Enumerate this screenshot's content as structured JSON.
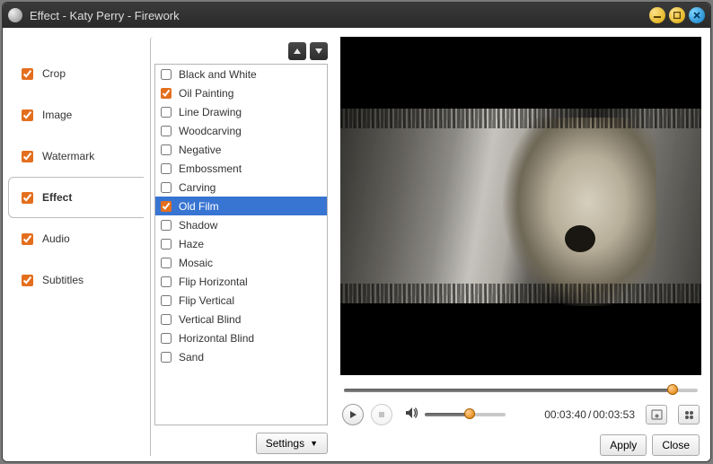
{
  "window": {
    "title": "Effect - Katy Perry - Firework"
  },
  "tabs": [
    {
      "id": "crop",
      "label": "Crop",
      "checked": true,
      "active": false
    },
    {
      "id": "image",
      "label": "Image",
      "checked": true,
      "active": false
    },
    {
      "id": "watermark",
      "label": "Watermark",
      "checked": true,
      "active": false
    },
    {
      "id": "effect",
      "label": "Effect",
      "checked": true,
      "active": true
    },
    {
      "id": "audio",
      "label": "Audio",
      "checked": true,
      "active": false
    },
    {
      "id": "subtitles",
      "label": "Subtitles",
      "checked": true,
      "active": false
    }
  ],
  "effects": [
    {
      "label": "Black and White",
      "checked": false,
      "selected": false
    },
    {
      "label": "Oil Painting",
      "checked": true,
      "selected": false
    },
    {
      "label": "Line Drawing",
      "checked": false,
      "selected": false
    },
    {
      "label": "Woodcarving",
      "checked": false,
      "selected": false
    },
    {
      "label": "Negative",
      "checked": false,
      "selected": false
    },
    {
      "label": "Embossment",
      "checked": false,
      "selected": false
    },
    {
      "label": "Carving",
      "checked": false,
      "selected": false
    },
    {
      "label": "Old Film",
      "checked": true,
      "selected": true
    },
    {
      "label": "Shadow",
      "checked": false,
      "selected": false
    },
    {
      "label": "Haze",
      "checked": false,
      "selected": false
    },
    {
      "label": "Mosaic",
      "checked": false,
      "selected": false
    },
    {
      "label": "Flip Horizontal",
      "checked": false,
      "selected": false
    },
    {
      "label": "Flip Vertical",
      "checked": false,
      "selected": false
    },
    {
      "label": "Vertical Blind",
      "checked": false,
      "selected": false
    },
    {
      "label": "Horizontal Blind",
      "checked": false,
      "selected": false
    },
    {
      "label": "Sand",
      "checked": false,
      "selected": false
    }
  ],
  "buttons": {
    "settings": "Settings",
    "apply": "Apply",
    "close": "Close"
  },
  "playback": {
    "current": "00:03:40",
    "separator": " / ",
    "total": "00:03:53",
    "seek_percent": 93,
    "volume_percent": 55
  }
}
